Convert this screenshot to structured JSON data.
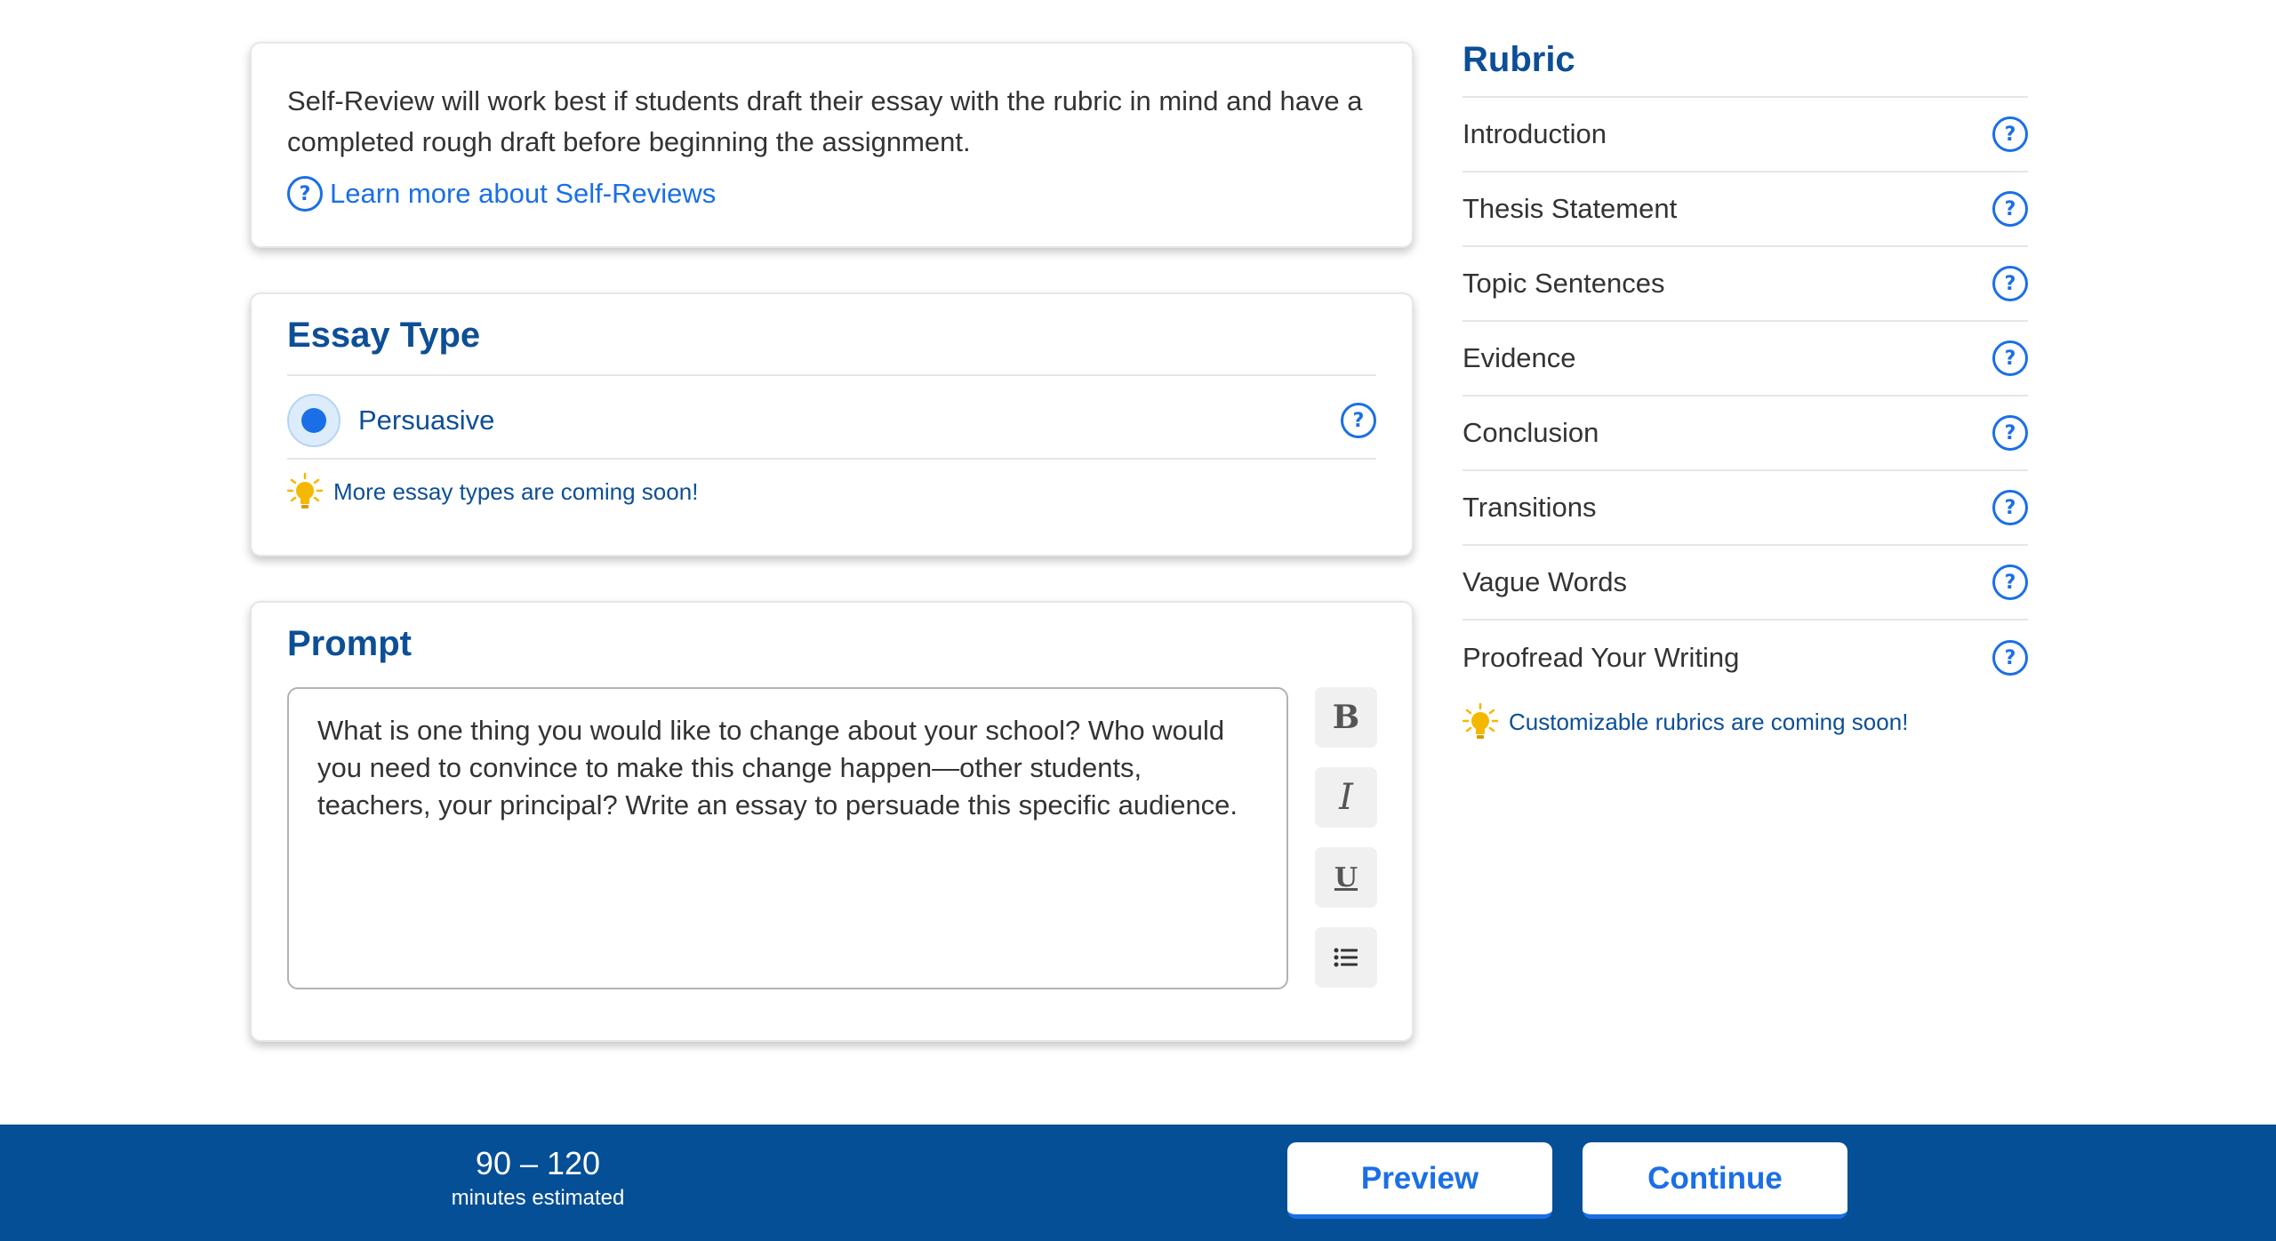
{
  "info": {
    "text": "Self-Review will work best if students draft their essay with the rubric in mind and have a completed rough draft before beginning the assignment.",
    "learn_more": "Learn more about Self-Reviews",
    "help_glyph": "?"
  },
  "essay_type": {
    "title": "Essay Type",
    "option": "Persuasive",
    "tip": "More essay types are coming soon!"
  },
  "prompt": {
    "title": "Prompt",
    "text": "What is one thing you would like to change about your school? Who would you need to convince to make this change happen—other students, teachers, your principal? Write an essay to persuade this specific audience.",
    "format_buttons": {
      "bold": "B",
      "italic": "I",
      "underline": "U",
      "list": "list-icon"
    }
  },
  "rubric": {
    "title": "Rubric",
    "items": [
      "Introduction",
      "Thesis Statement",
      "Topic Sentences",
      "Evidence",
      "Conclusion",
      "Transitions",
      "Vague Words",
      "Proofread Your Writing"
    ],
    "tip": "Customizable rubrics are coming soon!"
  },
  "footer": {
    "range": "90 – 120",
    "range_label": "minutes estimated",
    "preview": "Preview",
    "continue": "Continue"
  },
  "colors": {
    "accent": "#1a6fe6",
    "heading": "#0d4f96",
    "footer_bg": "#054f96",
    "tip_bulb": "#f5b800"
  }
}
